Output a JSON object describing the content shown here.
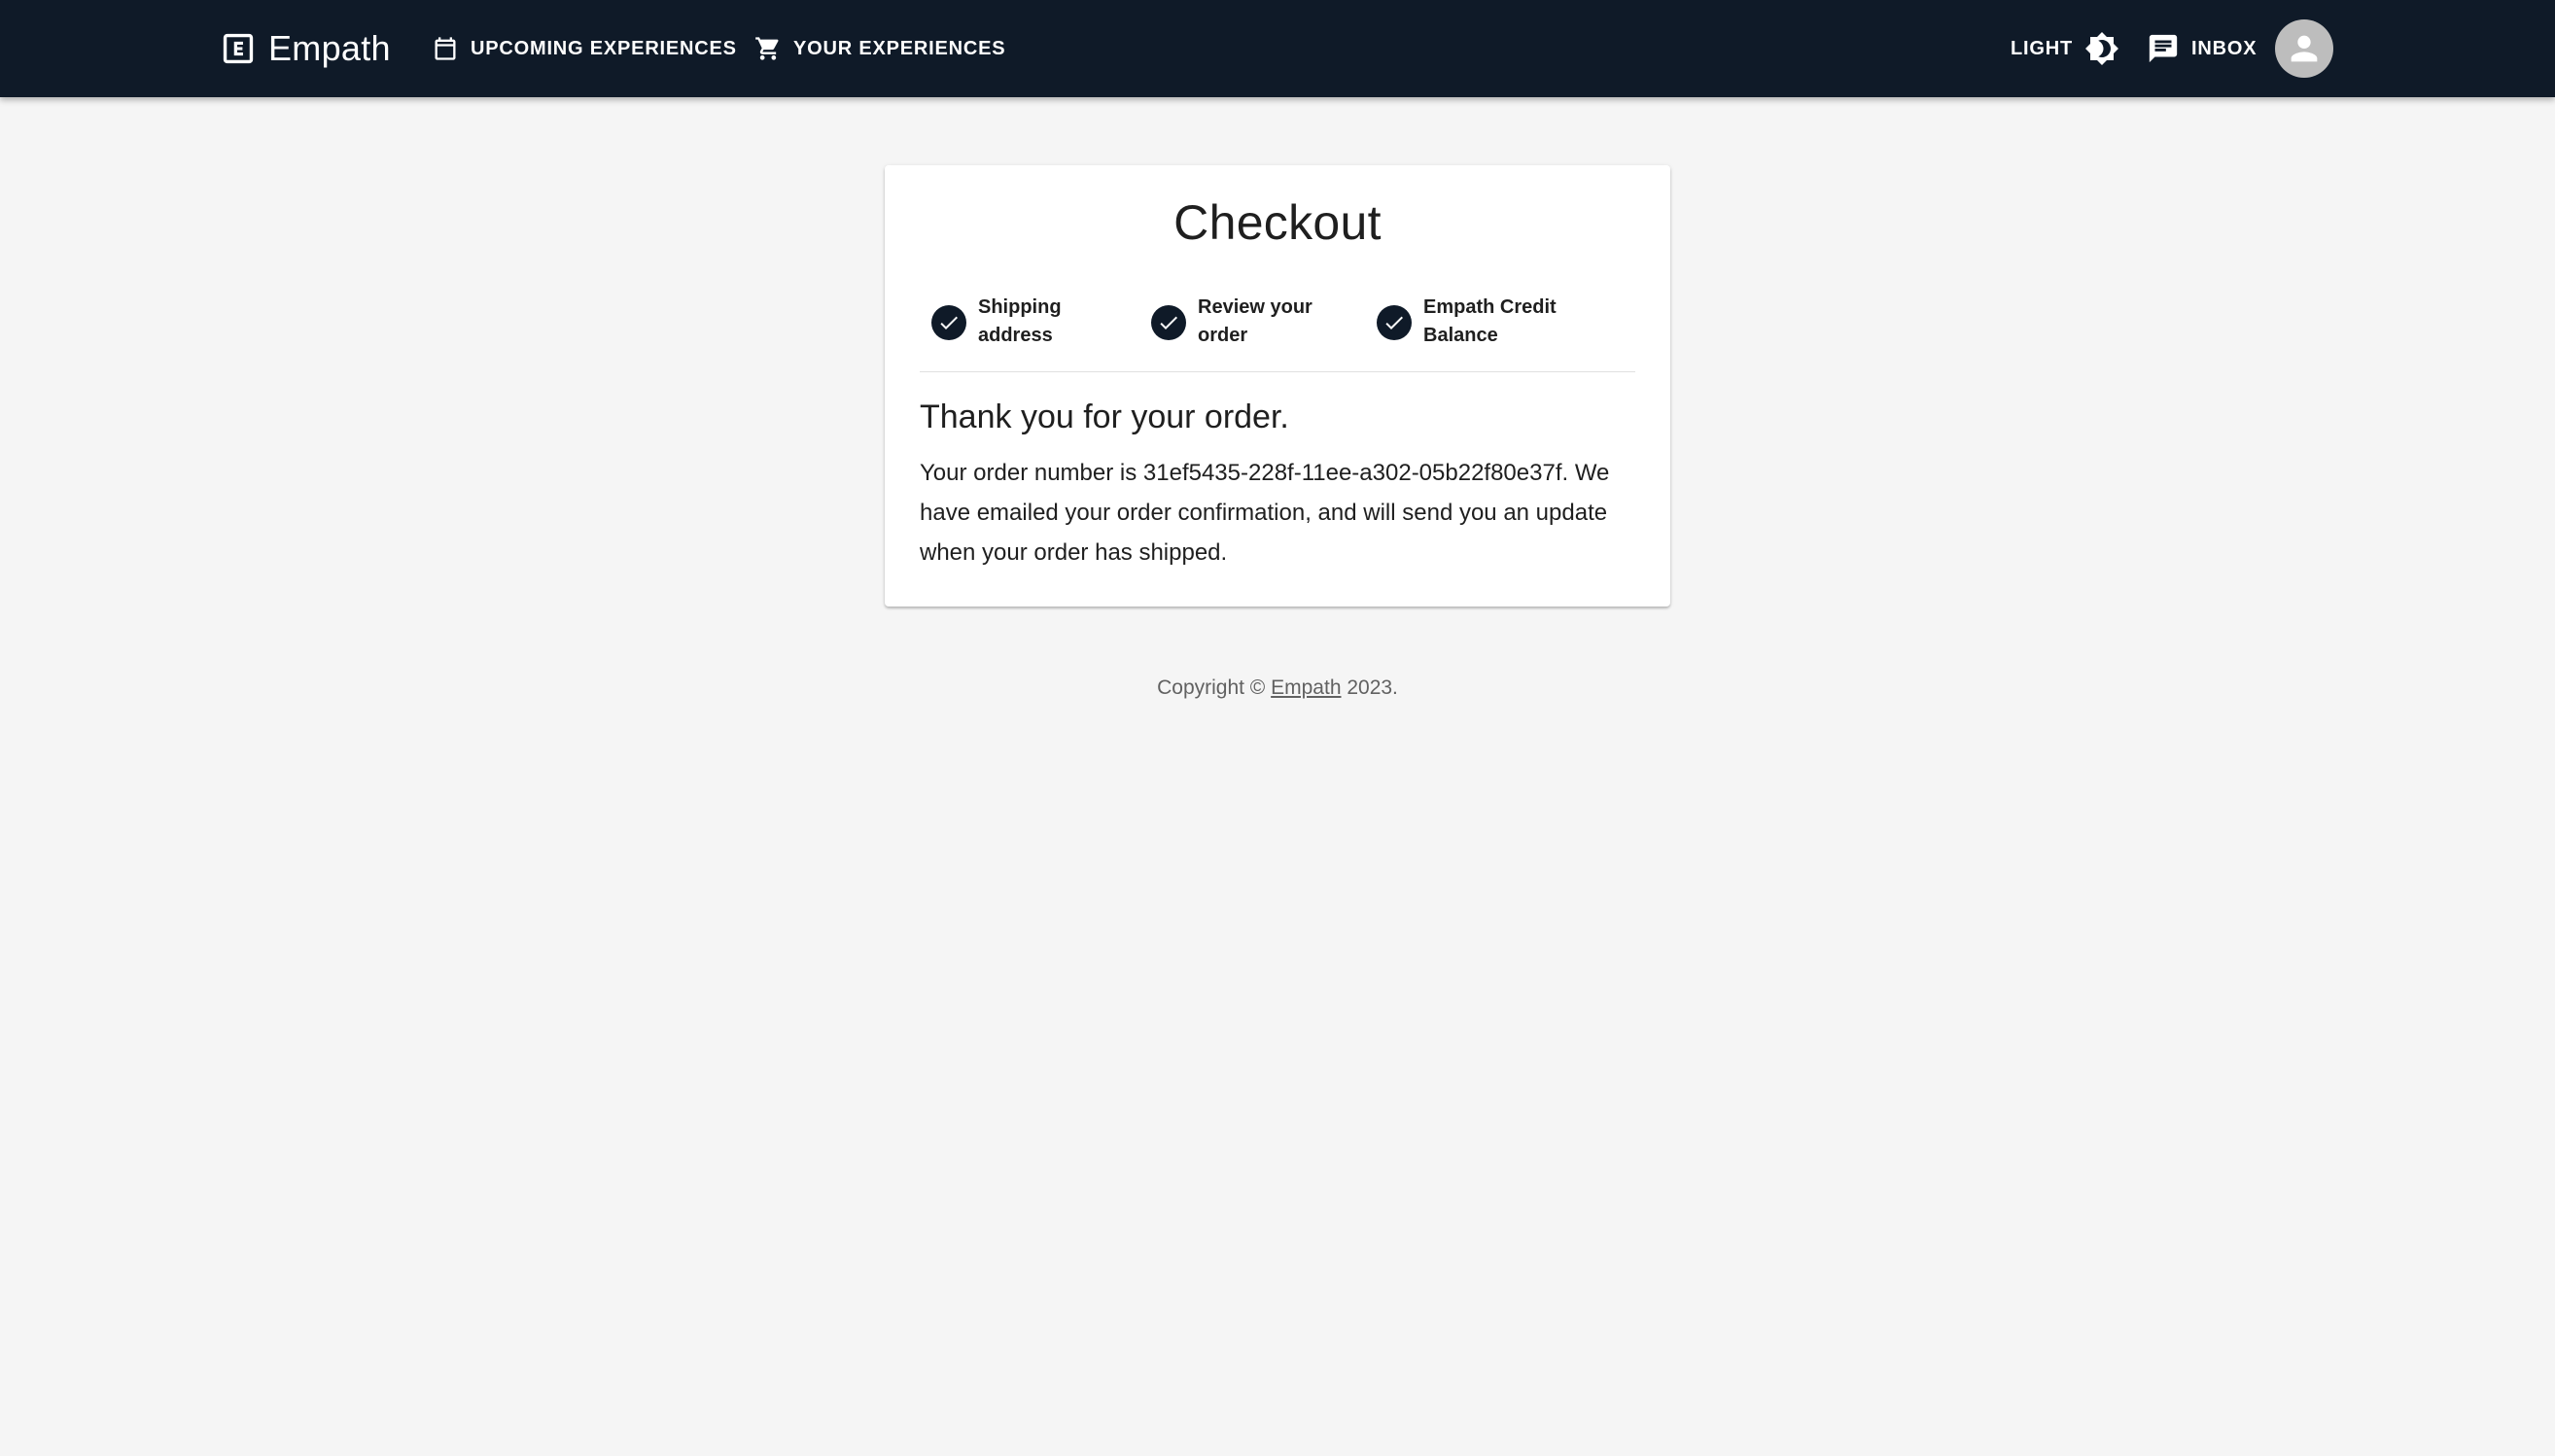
{
  "appbar": {
    "brand_name": "Empath",
    "nav": {
      "upcoming_label": "UPCOMING EXPERIENCES",
      "yours_label": "YOUR EXPERIENCES",
      "theme_label": "LIGHT",
      "inbox_label": "INBOX"
    },
    "icons": {
      "brand": "empath-logo-icon",
      "upcoming": "calendar-icon",
      "yours": "shopping-cart-icon",
      "theme": "brightness-icon",
      "inbox": "chat-icon",
      "avatar": "person-icon"
    },
    "colors": {
      "background": "#0f1a28",
      "text": "#ffffff"
    }
  },
  "checkout": {
    "title": "Checkout",
    "steps": [
      {
        "label": "Shipping address",
        "status": "completed",
        "icon": "check-icon"
      },
      {
        "label": "Review your order",
        "status": "completed",
        "icon": "check-icon"
      },
      {
        "label": "Empath Credit Balance",
        "status": "completed",
        "icon": "check-icon"
      }
    ],
    "thanks_heading": "Thank you for your order.",
    "order_message": "Your order number is 31ef5435-228f-11ee-a302-05b22f80e37f. We have emailed your order confirmation, and will send you an update when your order has shipped."
  },
  "footer": {
    "prefix": "Copyright © ",
    "link_text": "Empath",
    "suffix": " 2023."
  }
}
